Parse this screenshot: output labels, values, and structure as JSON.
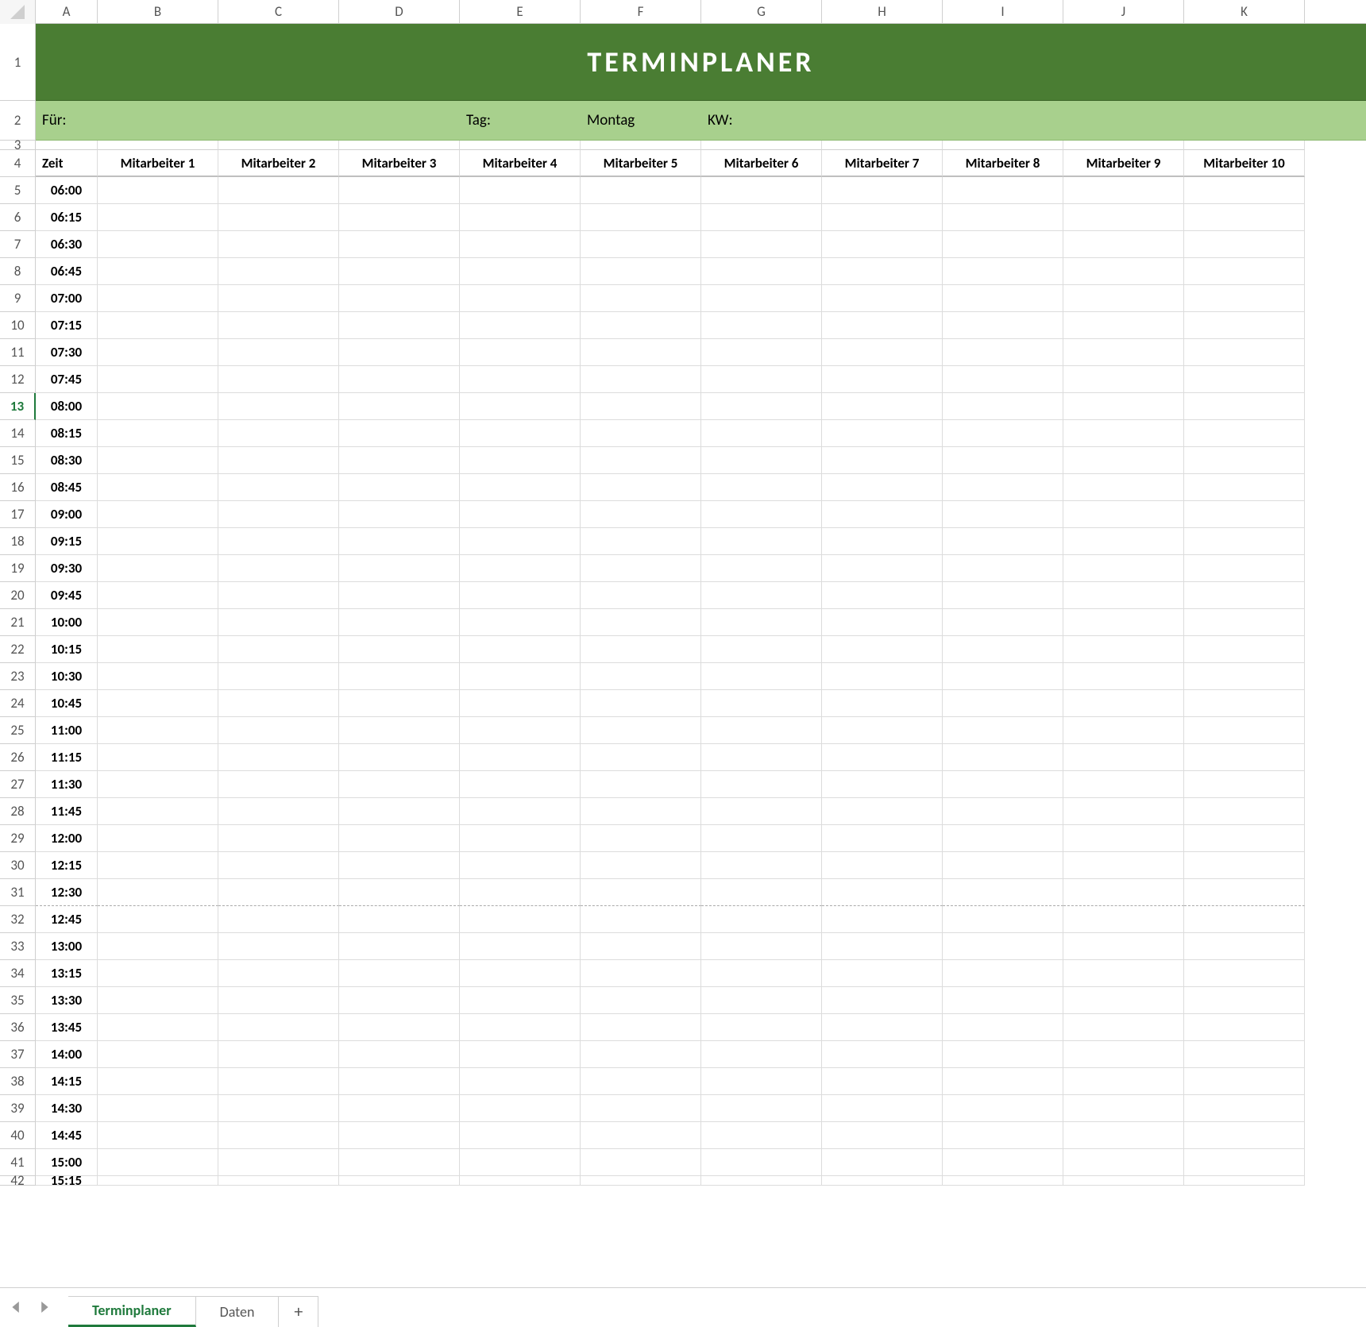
{
  "columns_letters": [
    "A",
    "B",
    "C",
    "D",
    "E",
    "F",
    "G",
    "H",
    "I",
    "J",
    "K"
  ],
  "title": "TERMINPLANER",
  "info": {
    "fur_label": "Für:",
    "tag_label": "Tag:",
    "tag_value": "Montag",
    "kw_label": "KW:"
  },
  "headers": [
    "Zeit",
    "Mitarbeiter 1",
    "Mitarbeiter 2",
    "Mitarbeiter 3",
    "Mitarbeiter 4",
    "Mitarbeiter 5",
    "Mitarbeiter 6",
    "Mitarbeiter 7",
    "Mitarbeiter 8",
    "Mitarbeiter 9",
    "Mitarbeiter 10"
  ],
  "times": [
    "06:00",
    "06:15",
    "06:30",
    "06:45",
    "07:00",
    "07:15",
    "07:30",
    "07:45",
    "08:00",
    "08:15",
    "08:30",
    "08:45",
    "09:00",
    "09:15",
    "09:30",
    "09:45",
    "10:00",
    "10:15",
    "10:30",
    "10:45",
    "11:00",
    "11:15",
    "11:30",
    "11:45",
    "12:00",
    "12:15",
    "12:30",
    "12:45",
    "13:00",
    "13:15",
    "13:30",
    "13:45",
    "14:00",
    "14:15",
    "14:30",
    "14:45",
    "15:00",
    "15:15"
  ],
  "first_data_rownum": 5,
  "active_row": 13,
  "page_break_after_row": 31,
  "sheet_tabs": {
    "active": "Terminplaner",
    "others": [
      "Daten"
    ],
    "add_label": "+"
  }
}
